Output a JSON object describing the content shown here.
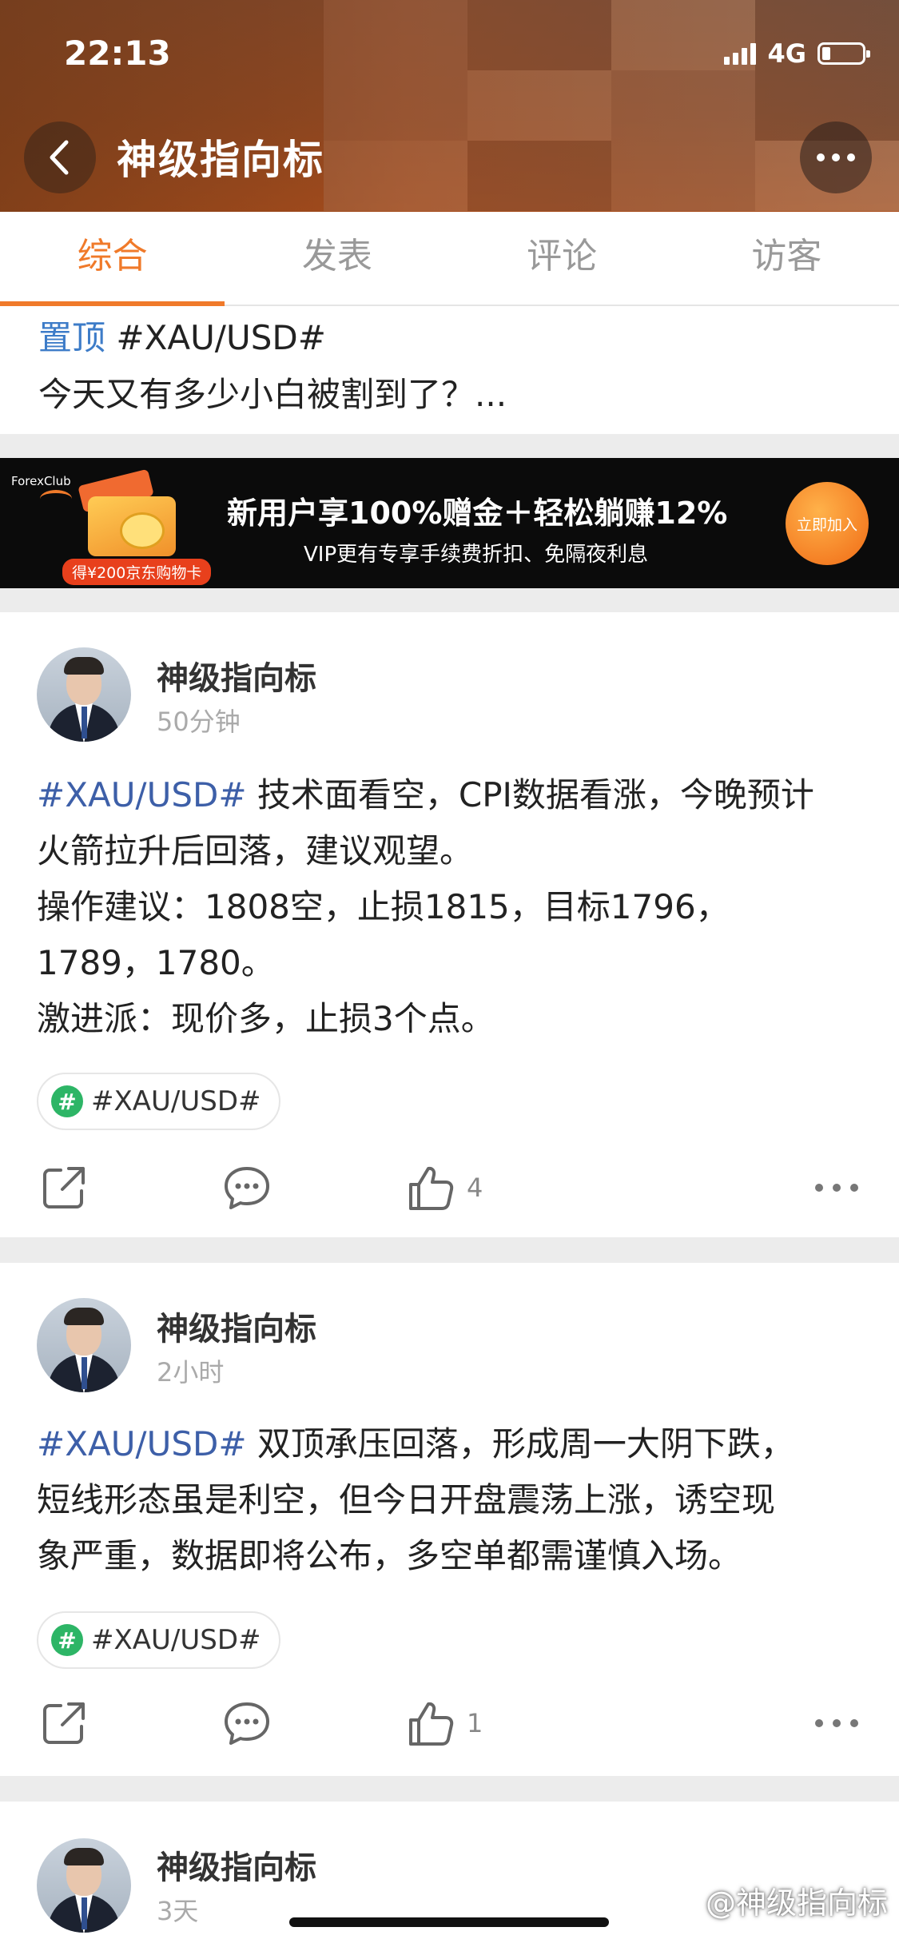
{
  "status_bar": {
    "time": "22:13",
    "network": "4G"
  },
  "header": {
    "title": "神级指向标"
  },
  "tabs": [
    {
      "label": "综合",
      "active": true
    },
    {
      "label": "发表",
      "active": false
    },
    {
      "label": "评论",
      "active": false
    },
    {
      "label": "访客",
      "active": false
    }
  ],
  "pinned": {
    "badge": "置顶",
    "hashtag": "#XAU/USD#",
    "text": "今天又有多少小白被割到了？..."
  },
  "banner": {
    "brand": "ForexClub",
    "gift_label": "得¥200京东购物卡",
    "headline": "新用户享100%赠金＋轻松躺赚12%",
    "subline": "VIP更有专享手续费折扣、免隔夜利息",
    "button": "立即加入"
  },
  "posts": [
    {
      "author": "神级指向标",
      "time": "50分钟",
      "hashtag": "#XAU/USD#",
      "lines": [
        " 技术面看空，CPI数据看涨，今晚预计",
        "火箭拉升后回落，建议观望。",
        "操作建议：1808空，止损1815，目标1796，",
        "1789，1780。",
        "激进派：现价多，止损3个点。"
      ],
      "topic": "#XAU/USD#",
      "likes": "4"
    },
    {
      "author": "神级指向标",
      "time": "2小时",
      "hashtag": "#XAU/USD#",
      "lines": [
        " 双顶承压回落，形成周一大阴下跌，",
        "短线形态虽是利空，但今日开盘震荡上涨，诱空现",
        "象严重，数据即将公布，多空单都需谨慎入场。"
      ],
      "topic": "#XAU/USD#",
      "likes": "1"
    },
    {
      "author": "神级指向标",
      "time": "3天"
    }
  ],
  "watermark": "@神级指向标",
  "colors": {
    "accent": "#f07a2a",
    "hashtag": "#3d5fa8",
    "pinned": "#3d7cc8",
    "topic_icon": "#2db566"
  },
  "icons": [
    "back-icon",
    "more-icon",
    "share-icon",
    "comment-icon",
    "like-icon",
    "hashtag-icon"
  ]
}
